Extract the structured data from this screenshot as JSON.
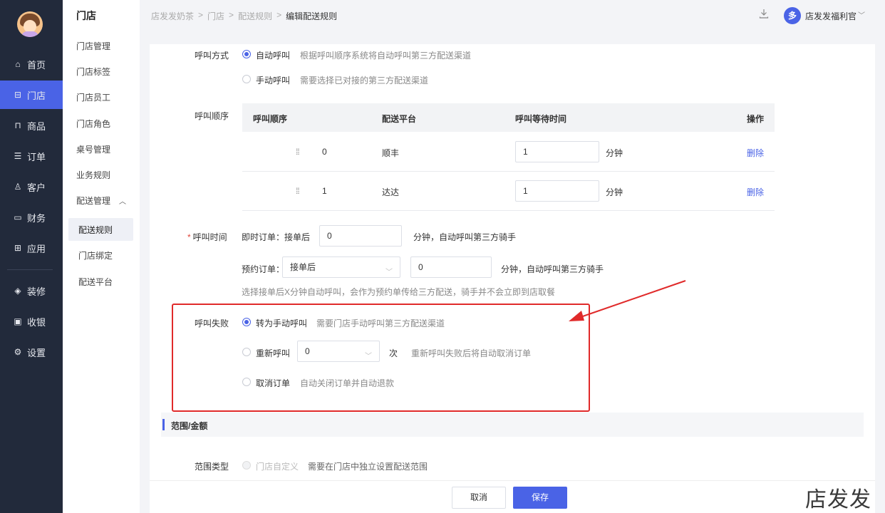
{
  "nav": {
    "items": [
      {
        "label": "首页",
        "icon": "home-icon",
        "glyph": "⌂"
      },
      {
        "label": "门店",
        "icon": "store-icon",
        "glyph": "⊟"
      },
      {
        "label": "商品",
        "icon": "bag-icon",
        "glyph": "⊓"
      },
      {
        "label": "订单",
        "icon": "order-icon",
        "glyph": "☰"
      },
      {
        "label": "客户",
        "icon": "user-icon",
        "glyph": "♙"
      },
      {
        "label": "财务",
        "icon": "wallet-icon",
        "glyph": "▭"
      },
      {
        "label": "应用",
        "icon": "apps-icon",
        "glyph": "⊞"
      },
      {
        "label": "装修",
        "icon": "layers-icon",
        "glyph": "◈"
      },
      {
        "label": "收银",
        "icon": "cashier-icon",
        "glyph": "▣"
      },
      {
        "label": "设置",
        "icon": "settings-icon",
        "glyph": "⚙"
      }
    ]
  },
  "sub": {
    "title": "门店",
    "items": [
      "门店管理",
      "门店标签",
      "门店员工",
      "门店角色",
      "桌号管理",
      "业务规则",
      "配送管理"
    ],
    "children": [
      "配送规则",
      "门店绑定",
      "配送平台"
    ]
  },
  "breadcrumb": {
    "items": [
      "店发发奶茶",
      "门店",
      "配送规则"
    ],
    "current": "编辑配送规则",
    "sep": ">"
  },
  "user": {
    "badge": "多",
    "name": "店发发福利官"
  },
  "form": {
    "call_mode": {
      "label": "呼叫方式",
      "auto": {
        "label": "自动呼叫",
        "hint": "根据呼叫顺序系统将自动呼叫第三方配送渠道"
      },
      "manual": {
        "label": "手动呼叫",
        "hint": "需要选择已对接的第三方配送渠道"
      }
    },
    "call_order": {
      "label": "呼叫顺序",
      "headers": {
        "order": "呼叫顺序",
        "platform": "配送平台",
        "wait": "呼叫等待时间",
        "action": "操作"
      },
      "rows": [
        {
          "order": "0",
          "platform": "顺丰",
          "wait": "1",
          "unit": "分钟",
          "action": "删除"
        },
        {
          "order": "1",
          "platform": "达达",
          "wait": "1",
          "unit": "分钟",
          "action": "删除"
        }
      ]
    },
    "call_time": {
      "label": "呼叫时间",
      "required": "*",
      "instant": {
        "prefix": "即时订单：接单后",
        "value": "0",
        "suffix": "分钟，自动呼叫第三方骑手"
      },
      "reserve": {
        "prefix": "预约订单：",
        "select": "接单后",
        "value": "0",
        "suffix": "分钟，自动呼叫第三方骑手"
      },
      "hint": "选择接单后X分钟自动呼叫，会作为预约单传给三方配送，骑手并不会立即到店取餐"
    },
    "call_fail": {
      "label": "呼叫失败",
      "to_manual": {
        "label": "转为手动呼叫",
        "hint": "需要门店手动呼叫第三方配送渠道"
      },
      "retry": {
        "label": "重新呼叫",
        "select": "0",
        "unit": "次",
        "hint": "重新呼叫失败后将自动取消订单"
      },
      "cancel": {
        "label": "取消订单",
        "hint": "自动关闭订单并自动退款"
      }
    },
    "section_range": "范围/金额",
    "range_type": {
      "label": "范围类型",
      "option": "门店自定义",
      "hint": "需要在门店中独立设置配送范围"
    }
  },
  "footer": {
    "cancel": "取消",
    "save": "保存"
  },
  "watermark": "店发发",
  "colors": {
    "accent": "#4a63e6",
    "sidebar": "#222a3b",
    "annotation": "#e02a2a"
  }
}
